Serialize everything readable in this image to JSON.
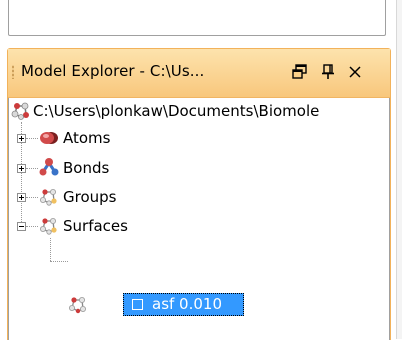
{
  "panel": {
    "title": "Model Explorer - C:\\Us...",
    "buttons": {
      "restore": "restore-window-icon",
      "pin": "pin-icon",
      "close": "close-icon"
    },
    "accent_color": "#f8c77c",
    "selection_color": "#3399ff"
  },
  "tree": {
    "root": {
      "label": "C:\\Users\\plonkaw\\Documents\\Biomole",
      "icon": "model-molecule-icon"
    },
    "items": [
      {
        "label": "Atoms",
        "icon": "atoms-icon",
        "expander": "+"
      },
      {
        "label": "Bonds",
        "icon": "bonds-icon",
        "expander": "+"
      },
      {
        "label": "Groups",
        "icon": "groups-icon",
        "expander": "+"
      },
      {
        "label": "Surfaces",
        "icon": "surfaces-icon",
        "expander": "−"
      }
    ],
    "surface_child": {
      "label": "asf 0.010",
      "icon": "surface-item-icon",
      "selected": true
    }
  }
}
